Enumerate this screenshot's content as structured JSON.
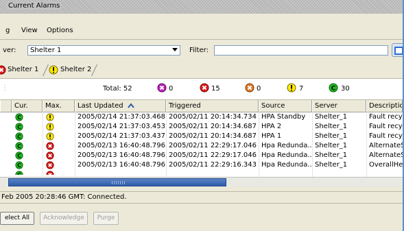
{
  "window": {
    "title": "Current Alarms"
  },
  "menu": [
    "g",
    "View",
    "Options"
  ],
  "server_label": "ver:",
  "server_value": "Shelter 1",
  "filter_label": "Filter:",
  "filter_value": "",
  "tabs": [
    {
      "label": "Shelter 1",
      "icon": "critical-icon"
    },
    {
      "label": "Shelter 2",
      "icon": "warning-icon"
    }
  ],
  "summary": {
    "total_label": "Total: 52",
    "counts": [
      {
        "icon": "major-alarm-icon",
        "color": "#c020c0",
        "value": "0"
      },
      {
        "icon": "critical-alarm-icon",
        "color": "#dd1c1c",
        "value": "15"
      },
      {
        "icon": "minor-alarm-icon",
        "color": "#e07b2a",
        "value": "0"
      },
      {
        "icon": "warning-alarm-icon",
        "color": "#ffea00",
        "value": "7"
      },
      {
        "icon": "cleared-alarm-icon",
        "color": "#1fbf1f",
        "value": "30"
      }
    ]
  },
  "table": {
    "columns": [
      "Cur.",
      "Max.",
      "Last Updated",
      "Triggered",
      "Source",
      "Server",
      "Description"
    ],
    "sort_column": "Last Updated",
    "rows": [
      {
        "cur": "cleared",
        "max": "warning",
        "last_updated": "2005/02/14 21:37:03.468",
        "triggered": "2005/02/11 20:14:34.734",
        "source": "HPA Standby",
        "server": "Shelter_1",
        "description": "Fault recycl"
      },
      {
        "cur": "cleared",
        "max": "warning",
        "last_updated": "2005/02/14 21:37:03.453",
        "triggered": "2005/02/11 20:14:34.687",
        "source": "HPA 2",
        "server": "Shelter_1",
        "description": "Fault recycl"
      },
      {
        "cur": "cleared",
        "max": "warning",
        "last_updated": "2005/02/14 21:37:03.437",
        "triggered": "2005/02/11 20:14:34.687",
        "source": "HPA 1",
        "server": "Shelter_1",
        "description": "Fault recycl"
      },
      {
        "cur": "cleared",
        "max": "critical",
        "last_updated": "2005/02/13 16:40:48.796",
        "triggered": "2005/02/11 22:29:17.046",
        "source": "Hpa Redunda...",
        "server": "Shelter_1",
        "description": "AlternateSe"
      },
      {
        "cur": "cleared",
        "max": "critical",
        "last_updated": "2005/02/13 16:40:48.796",
        "triggered": "2005/02/11 22:29:17.046",
        "source": "Hpa Redunda...",
        "server": "Shelter_1",
        "description": "AlternateSe"
      },
      {
        "cur": "cleared",
        "max": "critical",
        "last_updated": "2005/02/13 16:40:48.796",
        "triggered": "2005/02/11 22:29:16.343",
        "source": "Hpa Redunda...",
        "server": "Shelter_1",
        "description": "OverallHeal"
      }
    ]
  },
  "status_text": "Feb 2005 20:28:46 GMT: Connected.",
  "buttons": {
    "select_all": "elect All",
    "acknowledge": "Acknowledge",
    "purge": "Purge"
  },
  "colors": {
    "accent": "#2e5da8",
    "cleared": "#1fbf1f",
    "warning": "#ffea00",
    "critical": "#dd1c1c"
  }
}
